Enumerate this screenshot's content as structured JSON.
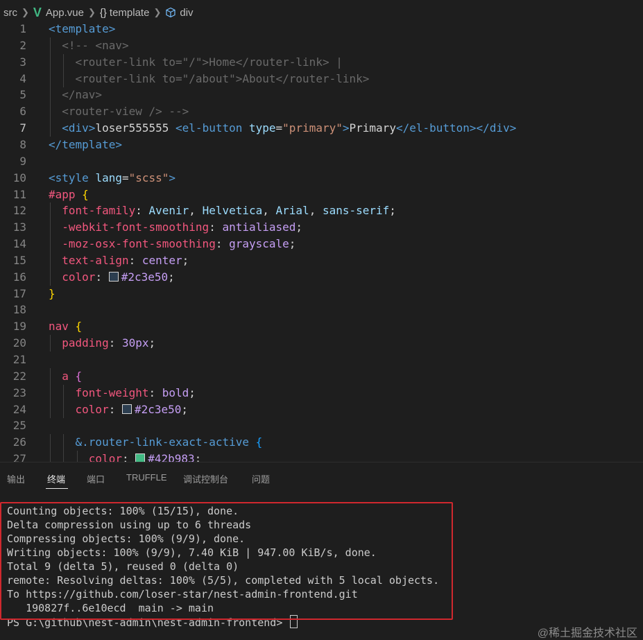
{
  "breadcrumb": {
    "folder": "src",
    "file": "App.vue",
    "braces": "{}",
    "section": "template",
    "element": "div",
    "file_icon": "V"
  },
  "editor": {
    "active_line": 7,
    "lines": [
      {
        "n": "1",
        "tokens": [
          [
            "tag",
            "<template>"
          ]
        ]
      },
      {
        "n": "2",
        "tokens": [
          [
            "ws",
            "  "
          ],
          [
            "comment",
            "<!-- <nav>"
          ]
        ]
      },
      {
        "n": "3",
        "tokens": [
          [
            "ws",
            "    "
          ],
          [
            "comment",
            "<router-link to=\"/\">Home</router-link> |"
          ]
        ]
      },
      {
        "n": "4",
        "tokens": [
          [
            "ws",
            "    "
          ],
          [
            "comment",
            "<router-link to=\"/about\">About</router-link>"
          ]
        ]
      },
      {
        "n": "5",
        "tokens": [
          [
            "ws",
            "  "
          ],
          [
            "comment",
            "</nav>"
          ]
        ]
      },
      {
        "n": "6",
        "tokens": [
          [
            "ws",
            "  "
          ],
          [
            "comment",
            "<router-view /> -->"
          ]
        ]
      },
      {
        "n": "7",
        "tokens": [
          [
            "ws",
            "  "
          ],
          [
            "tag",
            "<div>"
          ],
          [
            "text",
            "loser555555 "
          ],
          [
            "tag",
            "<el-button "
          ],
          [
            "attr",
            "type"
          ],
          [
            "text",
            "="
          ],
          [
            "string",
            "\"primary\""
          ],
          [
            "tag",
            ">"
          ],
          [
            "text",
            "Primary"
          ],
          [
            "tag",
            "</el-button></div>"
          ]
        ]
      },
      {
        "n": "8",
        "tokens": [
          [
            "tag",
            "</template>"
          ]
        ]
      },
      {
        "n": "9",
        "tokens": []
      },
      {
        "n": "10",
        "tokens": [
          [
            "tag",
            "<style "
          ],
          [
            "attr",
            "lang"
          ],
          [
            "text",
            "="
          ],
          [
            "string",
            "\"scss\""
          ],
          [
            "tag",
            ">"
          ]
        ]
      },
      {
        "n": "11",
        "tokens": [
          [
            "selector",
            "#app "
          ],
          [
            "brace",
            "{"
          ]
        ]
      },
      {
        "n": "12",
        "tokens": [
          [
            "ws",
            "  "
          ],
          [
            "prop",
            "font-family"
          ],
          [
            "text",
            ": "
          ],
          [
            "fontval",
            "Avenir"
          ],
          [
            "text",
            ", "
          ],
          [
            "fontval",
            "Helvetica"
          ],
          [
            "text",
            ", "
          ],
          [
            "fontval",
            "Arial"
          ],
          [
            "text",
            ", "
          ],
          [
            "fontval",
            "sans-serif"
          ],
          [
            "text",
            ";"
          ]
        ]
      },
      {
        "n": "13",
        "tokens": [
          [
            "ws",
            "  "
          ],
          [
            "prop",
            "-webkit-font-smoothing"
          ],
          [
            "text",
            ": "
          ],
          [
            "value",
            "antialiased"
          ],
          [
            "text",
            ";"
          ]
        ]
      },
      {
        "n": "14",
        "tokens": [
          [
            "ws",
            "  "
          ],
          [
            "prop",
            "-moz-osx-font-smoothing"
          ],
          [
            "text",
            ": "
          ],
          [
            "value",
            "grayscale"
          ],
          [
            "text",
            ";"
          ]
        ]
      },
      {
        "n": "15",
        "tokens": [
          [
            "ws",
            "  "
          ],
          [
            "prop",
            "text-align"
          ],
          [
            "text",
            ": "
          ],
          [
            "value",
            "center"
          ],
          [
            "text",
            ";"
          ]
        ]
      },
      {
        "n": "16",
        "tokens": [
          [
            "ws",
            "  "
          ],
          [
            "prop",
            "color"
          ],
          [
            "text",
            ": "
          ],
          [
            "swatch",
            "#2c3e50"
          ],
          [
            "value",
            "#2c3e50"
          ],
          [
            "text",
            ";"
          ]
        ]
      },
      {
        "n": "17",
        "tokens": [
          [
            "brace",
            "}"
          ]
        ]
      },
      {
        "n": "18",
        "tokens": []
      },
      {
        "n": "19",
        "tokens": [
          [
            "selector",
            "nav "
          ],
          [
            "brace",
            "{"
          ]
        ]
      },
      {
        "n": "20",
        "tokens": [
          [
            "ws",
            "  "
          ],
          [
            "prop",
            "padding"
          ],
          [
            "text",
            ": "
          ],
          [
            "value",
            "30px"
          ],
          [
            "text",
            ";"
          ]
        ]
      },
      {
        "n": "21",
        "tokens": []
      },
      {
        "n": "22",
        "tokens": [
          [
            "ws",
            "  "
          ],
          [
            "selector",
            "a "
          ],
          [
            "brace2",
            "{"
          ]
        ]
      },
      {
        "n": "23",
        "tokens": [
          [
            "ws",
            "    "
          ],
          [
            "prop",
            "font-weight"
          ],
          [
            "text",
            ": "
          ],
          [
            "value",
            "bold"
          ],
          [
            "text",
            ";"
          ]
        ]
      },
      {
        "n": "24",
        "tokens": [
          [
            "ws",
            "    "
          ],
          [
            "prop",
            "color"
          ],
          [
            "text",
            ": "
          ],
          [
            "swatch",
            "#2c3e50"
          ],
          [
            "value",
            "#2c3e50"
          ],
          [
            "text",
            ";"
          ]
        ]
      },
      {
        "n": "25",
        "tokens": []
      },
      {
        "n": "26",
        "tokens": [
          [
            "ws",
            "    "
          ],
          [
            "selector2",
            "&.router-link-exact-active "
          ],
          [
            "brace3",
            "{"
          ]
        ]
      },
      {
        "n": "27",
        "tokens": [
          [
            "ws",
            "      "
          ],
          [
            "prop",
            "color"
          ],
          [
            "text",
            ": "
          ],
          [
            "swatch",
            "#42b983"
          ],
          [
            "value",
            "#42b983"
          ],
          [
            "text",
            ";"
          ]
        ]
      }
    ]
  },
  "panel": {
    "tabs": [
      "输出",
      "终端",
      "端口",
      "TRUFFLE",
      "调试控制台",
      "问题"
    ],
    "active_tab": 1
  },
  "terminal": {
    "lines": [
      "Counting objects: 100% (15/15), done.",
      "Delta compression using up to 6 threads",
      "Compressing objects: 100% (9/9), done.",
      "Writing objects: 100% (9/9), 7.40 KiB | 947.00 KiB/s, done.",
      "Total 9 (delta 5), reused 0 (delta 0)",
      "remote: Resolving deltas: 100% (5/5), completed with 5 local objects.",
      "To https://github.com/loser-star/nest-admin-frontend.git",
      "   190827f..6e10ecd  main -> main"
    ],
    "prompt": "PS G:\\github\\nest-admin\\nest-admin-frontend> "
  },
  "watermark": "@稀土掘金技术社区",
  "colors": {
    "tag": "#569cd6",
    "attr": "#9cdcfe",
    "string": "#ce9178",
    "comment": "#6a6a6a",
    "text": "#d4d4d4",
    "selector": "#f2577e",
    "selector2": "#569cd6",
    "prop": "#f2577e",
    "value": "#c69ff5",
    "fontval": "#9cdcfe",
    "brace": "#ffd700",
    "brace2": "#da70d6",
    "brace3": "#179fff",
    "highlight_border": "#d0282e"
  }
}
